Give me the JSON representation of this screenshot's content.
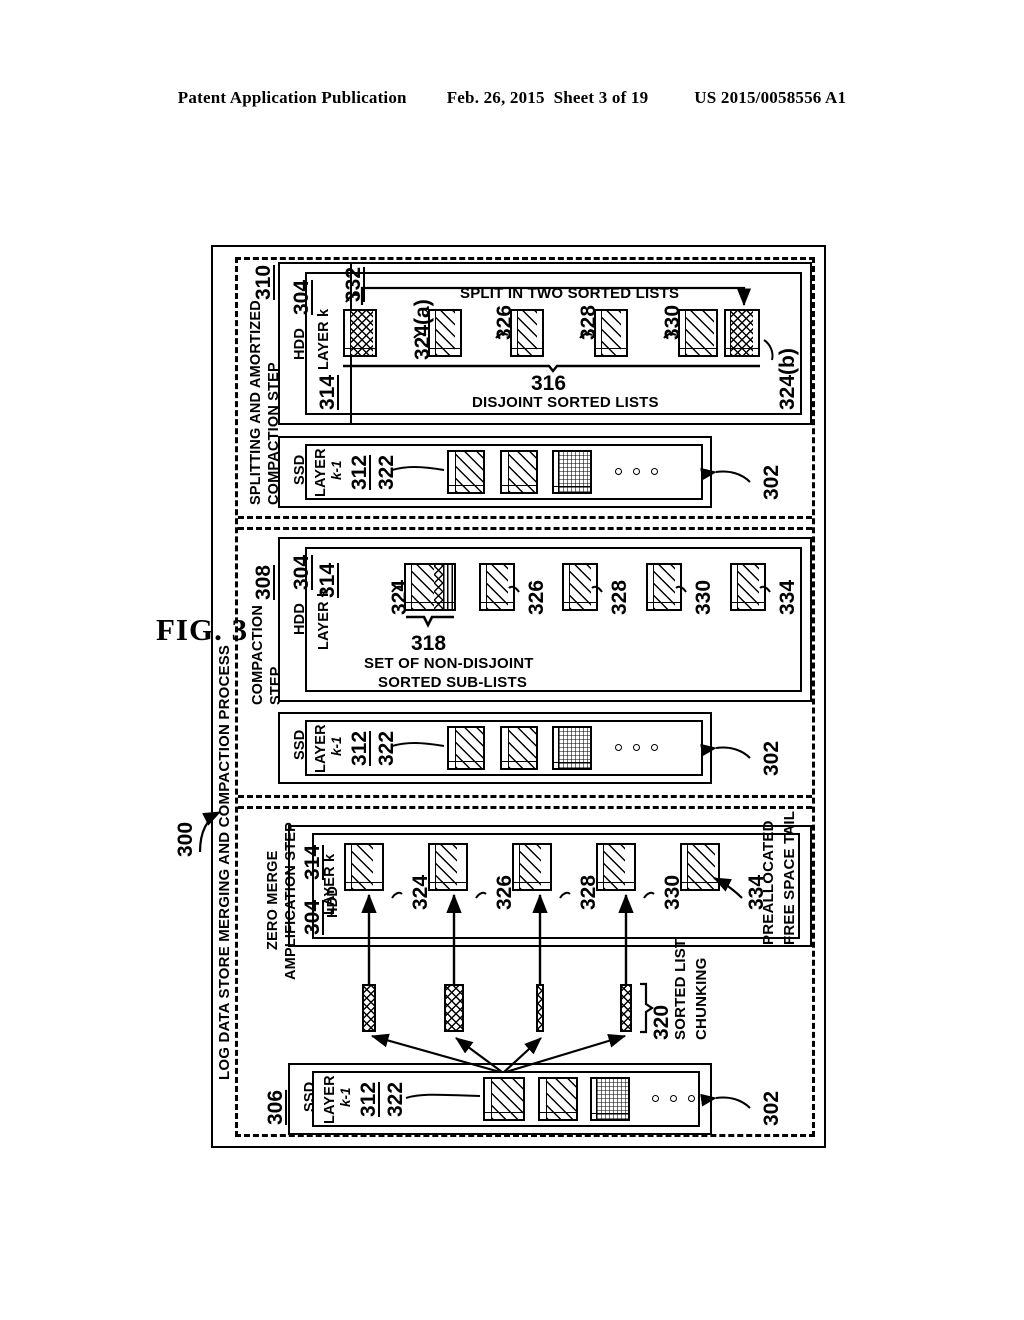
{
  "header": {
    "publication": "Patent Application Publication",
    "date": "Feb. 26, 2015",
    "sheet": "Sheet 3 of 19",
    "patent_number": "US 2015/0058556 A1"
  },
  "figure": {
    "label": "FIG. 3",
    "ref_300": "300",
    "process_title": "LOG DATA STORE MERGING AND COMPACTION PROCESS"
  },
  "panels": [
    {
      "id": "splitting",
      "ref": "310",
      "title_line1": "SPLITTING AND AMORTIZED",
      "title_line2": "COMPACTION STEP",
      "hdd": {
        "device_label": "HDD",
        "device_ref": "304",
        "layer_label": "LAYER k",
        "layer_ref": "314",
        "annotation_top": "SPLIT IN TWO SORTED LISTS",
        "brace_ref": "316",
        "brace_caption": "DISJOINT SORTED LISTS",
        "blocks": [
          {
            "ref": "332"
          },
          {
            "ref": "324(a)"
          },
          {
            "ref": "326"
          },
          {
            "ref": "328"
          },
          {
            "ref": "330"
          },
          {
            "ref": "324(b)"
          }
        ]
      },
      "ssd": {
        "device_label": "SSD",
        "layer_label": "LAYER",
        "layer_sub": "k-1",
        "layer_ref": "312",
        "block_ref": "322",
        "store_ref": "302"
      }
    },
    {
      "id": "compaction",
      "ref": "308",
      "title_line1": "COMPACTION",
      "title_line2": "STEP",
      "hdd": {
        "device_label": "HDD",
        "device_ref": "304",
        "layer_label": "LAYER k",
        "layer_ref": "314",
        "brace_ref": "318",
        "brace_caption_line1": "SET OF NON-DISJOINT",
        "brace_caption_line2": "SORTED SUB-LISTS",
        "blocks": [
          {
            "ref": "324"
          },
          {
            "ref": "326"
          },
          {
            "ref": "328"
          },
          {
            "ref": "330"
          },
          {
            "ref": "334"
          }
        ]
      },
      "ssd": {
        "device_label": "SSD",
        "layer_label": "LAYER",
        "layer_sub": "k-1",
        "layer_ref": "312",
        "block_ref": "322",
        "store_ref": "302"
      }
    },
    {
      "id": "zero-merge",
      "ref": "306",
      "title_line1": "ZERO MERGE",
      "title_line2": "AMPLIFICATION STEP",
      "hdd": {
        "device_label": "HDD",
        "device_ref": "304",
        "layer_label": "LAYER k",
        "layer_ref": "314",
        "tail_ref": "334",
        "tail_caption_line1": "PREALLOCATED",
        "tail_caption_line2": "FREE SPACE TAIL",
        "blocks": [
          {
            "ref": "324"
          },
          {
            "ref": "326"
          },
          {
            "ref": "328"
          },
          {
            "ref": "330"
          },
          {
            "ref": "334"
          }
        ]
      },
      "chunking": {
        "ref": "320",
        "caption_line1": "SORTED LIST",
        "caption_line2": "CHUNKING"
      },
      "ssd": {
        "device_label": "SSD",
        "layer_label": "LAYER",
        "layer_sub": "k-1",
        "layer_ref": "312",
        "block_ref": "322",
        "store_ref": "302"
      }
    }
  ]
}
